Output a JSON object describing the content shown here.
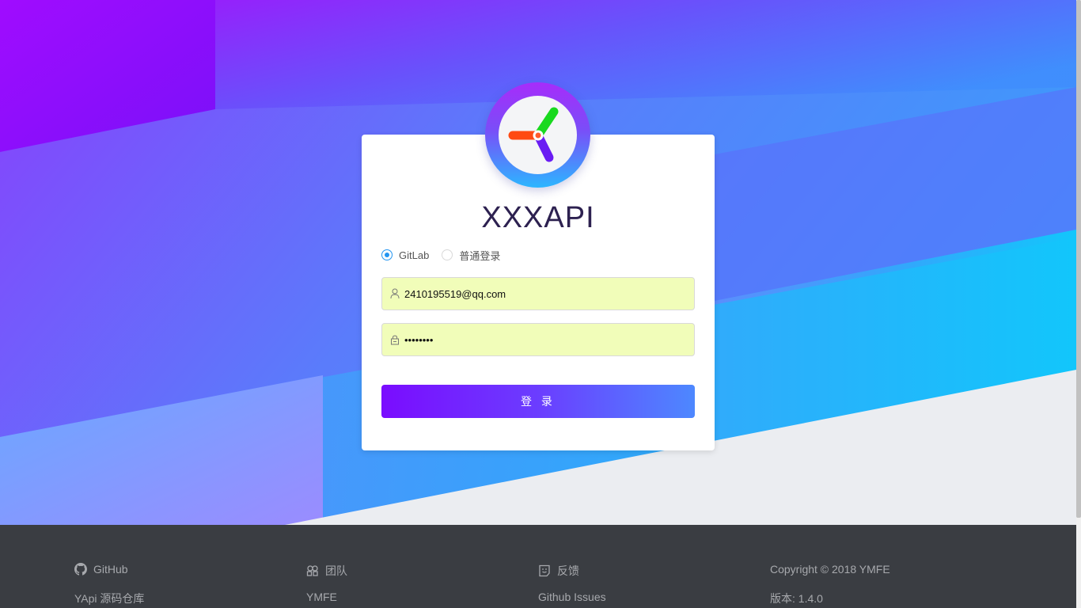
{
  "app": {
    "title": "XXXAPI"
  },
  "login": {
    "radios": [
      {
        "label": "GitLab",
        "checked": true
      },
      {
        "label": "普通登录",
        "checked": false
      }
    ],
    "email_value": "2410195519@qq.com",
    "password_value": "••••••••",
    "submit_label": "登 录"
  },
  "footer": {
    "columns": [
      {
        "icon": "github-icon",
        "heading": "GitHub",
        "link": "YApi 源码仓库"
      },
      {
        "icon": "team-icon",
        "heading": "团队",
        "link": "YMFE"
      },
      {
        "icon": "feedback-icon",
        "heading": "反馈",
        "link": "Github Issues"
      },
      {
        "icon": "",
        "heading": "Copyright © 2018 YMFE",
        "link": "版本: 1.4.0"
      }
    ]
  },
  "colors": {
    "accent": "#2395f1",
    "button_start": "#7a0cff",
    "button_end": "#4d88ff",
    "field_bg": "#f1fdb9",
    "footer_bg": "#3a3d42"
  }
}
